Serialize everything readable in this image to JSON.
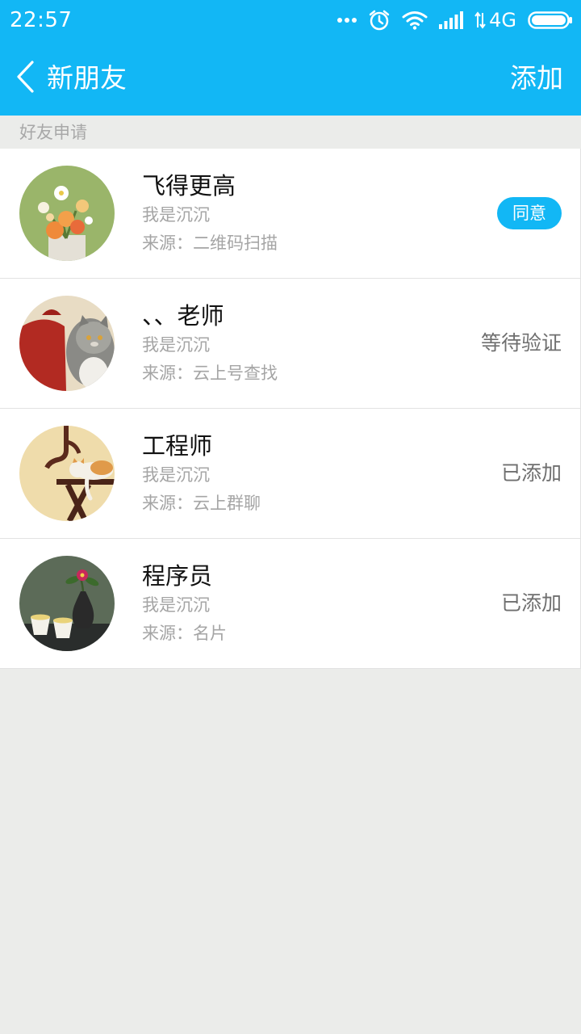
{
  "status_bar": {
    "time": "22:57",
    "network": "4G",
    "icons": [
      "more-dots-icon",
      "alarm-icon",
      "wifi-icon",
      "signal-icon",
      "data-arrows-icon",
      "battery-icon"
    ]
  },
  "header": {
    "back_icon": "chevron-left-icon",
    "title": "新朋友",
    "add_label": "添加",
    "color": "#12b7f5"
  },
  "section_label": "好友申请",
  "requests": [
    {
      "name": "飞得更高",
      "message": "我是沉沉",
      "source": "来源：二维码扫描",
      "action": "同意",
      "action_type": "button"
    },
    {
      "name": "、、老师",
      "message": "我是沉沉",
      "source": "来源：云上号查找",
      "action": "等待验证",
      "action_type": "text"
    },
    {
      "name": "工程师",
      "message": "我是沉沉",
      "source": "来源：云上群聊",
      "action": "已添加",
      "action_type": "text"
    },
    {
      "name": "程序员",
      "message": "我是沉沉",
      "source": "来源：名片",
      "action": "已添加",
      "action_type": "text"
    }
  ]
}
